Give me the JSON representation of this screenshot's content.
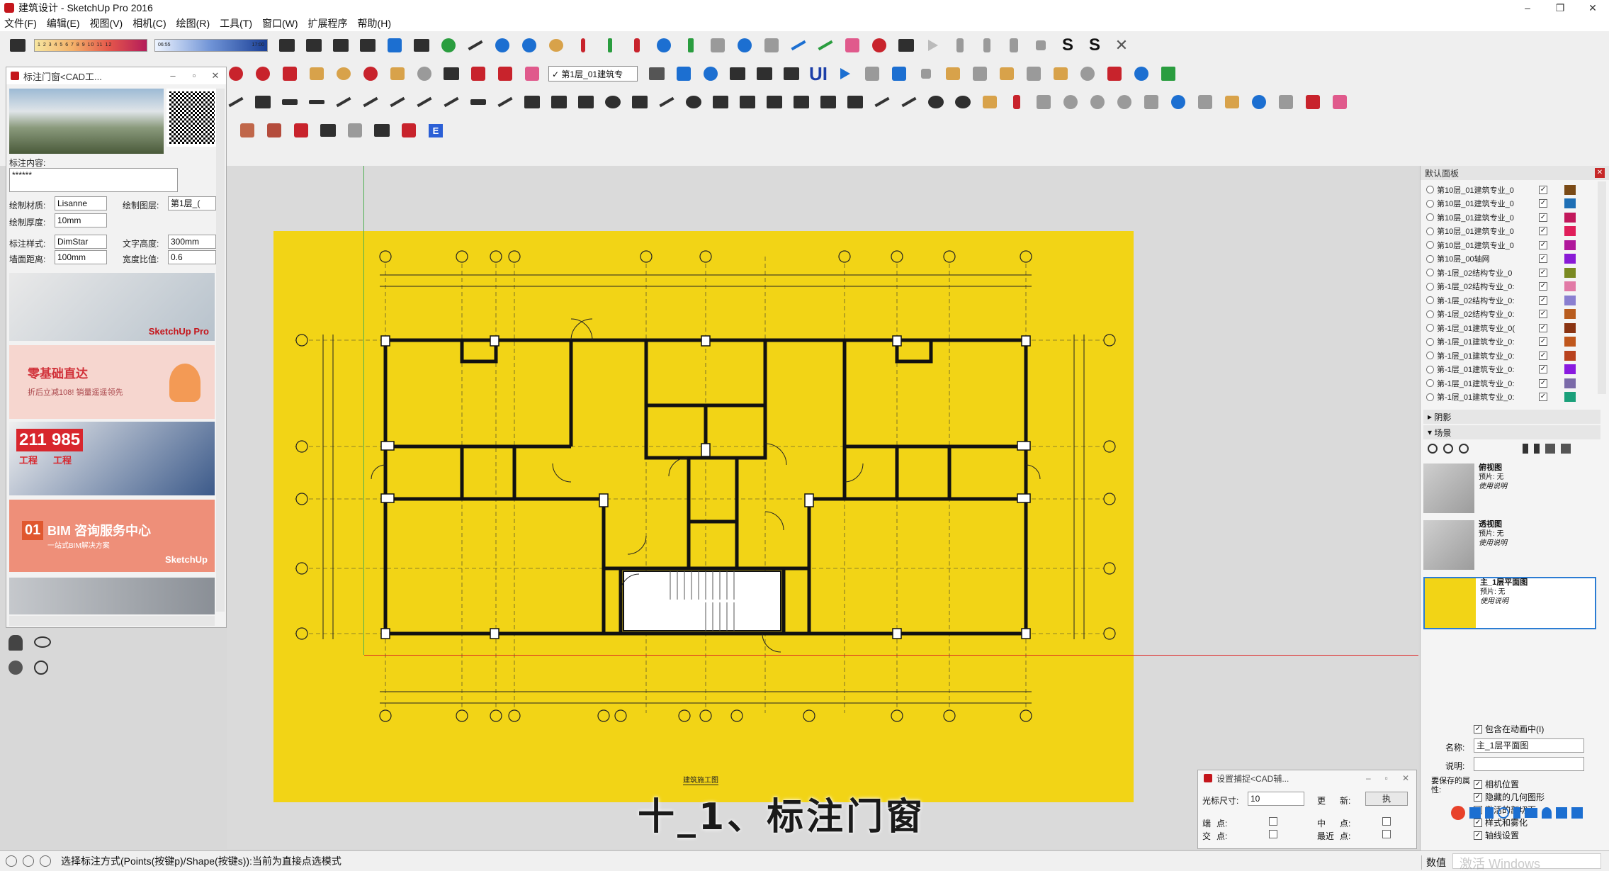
{
  "window": {
    "title": "建筑设计 - SketchUp Pro 2016",
    "minimize": "–",
    "maximize": "❐",
    "close": "✕"
  },
  "menu": [
    "文件(F)",
    "编辑(E)",
    "视图(V)",
    "相机(C)",
    "绘图(R)",
    "工具(T)",
    "窗口(W)",
    "扩展程序",
    "帮助(H)"
  ],
  "toolbar": {
    "legend1_text": "1 2 3 4 5 6 7 8 9 10 11 12",
    "legend2_left": "06:55",
    "legend2_right": "17:00",
    "layer_select": "✓ 第1层_01建筑专",
    "text_ui": "UI",
    "text_s1": "S",
    "text_s2": "S",
    "text_x": "✕",
    "text_e": "E"
  },
  "left_panel": {
    "title": "标注门窗<CAD工...",
    "label_content": "标注内容:",
    "content_value": "******",
    "label_material": "绘制材质:",
    "material_value": "Lisanne",
    "label_layer": "绘制图层:",
    "layer_value": "第1层_(",
    "label_thickness": "绘制厚度:",
    "thickness_value": "10mm",
    "label_style": "标注样式:",
    "style_value": "DimStar",
    "label_textheight": "文字高度:",
    "textheight_value": "300mm",
    "label_walldist": "墙面距离:",
    "walldist_value": "100mm",
    "label_ratio": "宽度比值:",
    "ratio_value": "0.6",
    "ad_sketchup": "SketchUp Pro",
    "ad_zero": "零基础直达",
    "ad_zero_sub": "折后立减108! 销量遥遥领先",
    "ad_211": "211",
    "ad_985": "985",
    "ad_gc1": "工程",
    "ad_gc2": "工程",
    "ad_bim": "BIM 咨询服务中心",
    "ad_bim_sub": "一站式BIM解决方案",
    "ad_01": "01",
    "ad_sketchup2": "SketchUp"
  },
  "canvas": {
    "subtitle": "十_1、标注门窗",
    "scale_label": "建筑施工图"
  },
  "right_panel": {
    "title": "默认面板",
    "layers": [
      {
        "name": "第10层_01建筑专业_0",
        "color": "#7a4a16"
      },
      {
        "name": "第10层_01建筑专业_0",
        "color": "#1e6fb5"
      },
      {
        "name": "第10层_01建筑专业_0",
        "color": "#c2185b"
      },
      {
        "name": "第10层_01建筑专业_0",
        "color": "#e01e5a"
      },
      {
        "name": "第10层_01建筑专业_0",
        "color": "#b0179b"
      },
      {
        "name": "第10层_00轴网",
        "color": "#8a1ad6"
      },
      {
        "name": "第-1层_02结构专业_0",
        "color": "#7a8a22"
      },
      {
        "name": "第-1层_02结构专业_0:",
        "color": "#e27aa6"
      },
      {
        "name": "第-1层_02结构专业_0:",
        "color": "#8a7fd0"
      },
      {
        "name": "第-1层_02结构专业_0:",
        "color": "#b85c1e"
      },
      {
        "name": "第-1层_01建筑专业_0(",
        "color": "#8a3412"
      },
      {
        "name": "第-1层_01建筑专业_0:",
        "color": "#c0571c"
      },
      {
        "name": "第-1层_01建筑专业_0:",
        "color": "#b8421e"
      },
      {
        "name": "第-1层_01建筑专业_0:",
        "color": "#8a1ae0"
      },
      {
        "name": "第-1层_01建筑专业_0:",
        "color": "#7a6aa8"
      },
      {
        "name": "第-1层_01建筑专业_0:",
        "color": "#1aa07a"
      }
    ],
    "shadow_label": "阴影",
    "scene_label": "场景",
    "scenes": [
      {
        "name": "俯视图",
        "line1": "预片: 无",
        "line2": "使用说明"
      },
      {
        "name": "透视图",
        "line1": "预片: 无",
        "line2": "使用说明"
      },
      {
        "name": "主_1层平面图",
        "line1": "预片: 无",
        "line2": "使用说明"
      }
    ],
    "include_anim": "包含在动画中(I)",
    "name_label": "名称:",
    "name_value": "主_1层平面图",
    "desc_label": "说明:",
    "save_label": "要保存的属性:",
    "opt_camera": "相机位置",
    "opt_hidden": "隐藏的几何图形",
    "opt_section": "激活的剖切面",
    "opt_style": "样式和雾化",
    "opt_axes": "轴线设置"
  },
  "snap_dialog": {
    "title": "设置捕捉<CAD辅...",
    "cursor_label": "光标尺寸:",
    "cursor_value": "10",
    "update_label": "更",
    "new_label": "新:",
    "exec_label": "执",
    "row2a": "端",
    "row2b": "点:",
    "row2c": "中",
    "row2d": "点:",
    "row3a": "交",
    "row3b": "点:",
    "row3c": "最近",
    "row3d": "点:"
  },
  "status": {
    "text": "选择标注方式(Points(按键p)/Shape(按键s)):当前为直接点选模式",
    "measure_label": "数值",
    "watermark": "激活 Windows"
  },
  "colors": {
    "sheet": "#f2d416",
    "accent": "#2b7cd3",
    "red_axis": "#d22"
  }
}
